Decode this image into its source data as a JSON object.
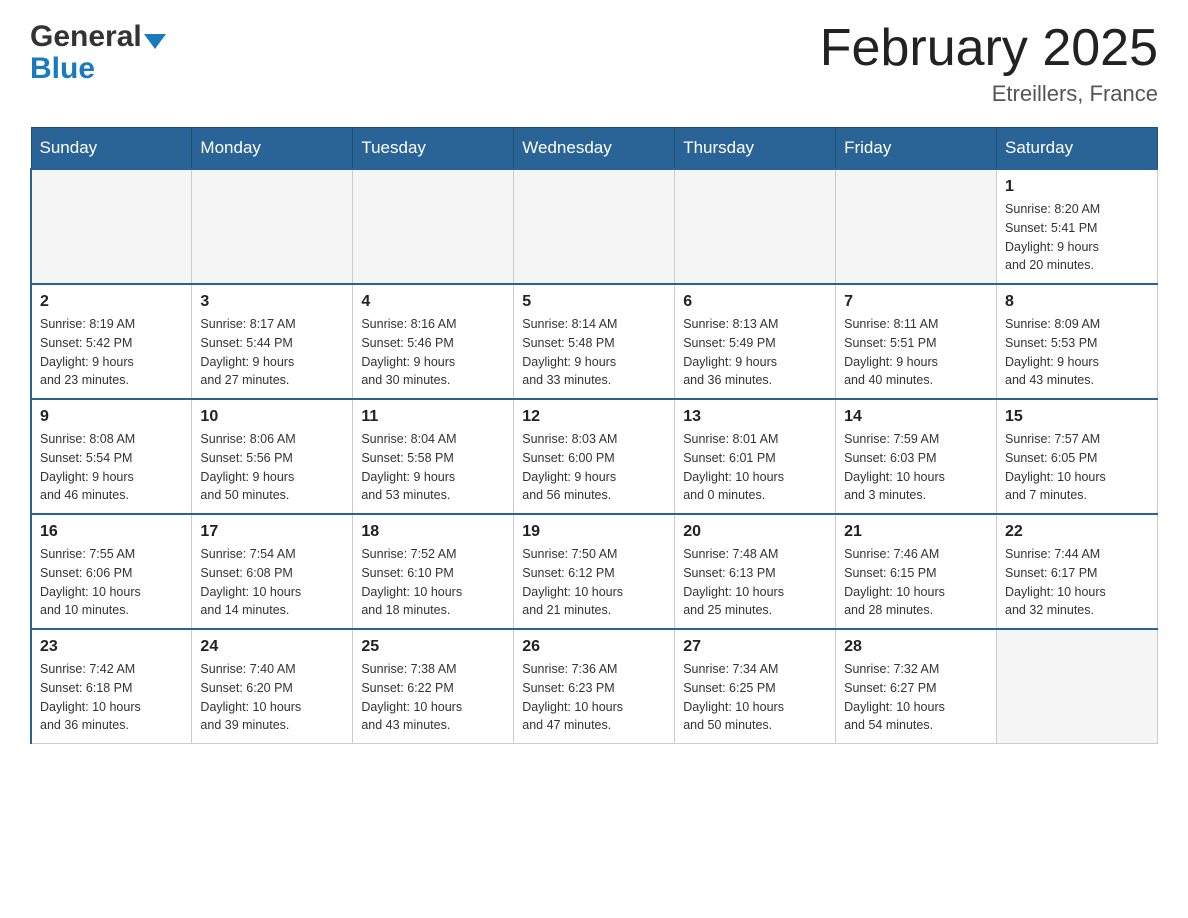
{
  "header": {
    "logo_general": "General",
    "logo_blue": "Blue",
    "month_title": "February 2025",
    "location": "Etreillers, France"
  },
  "weekdays": [
    "Sunday",
    "Monday",
    "Tuesday",
    "Wednesday",
    "Thursday",
    "Friday",
    "Saturday"
  ],
  "weeks": [
    [
      {
        "day": "",
        "info": ""
      },
      {
        "day": "",
        "info": ""
      },
      {
        "day": "",
        "info": ""
      },
      {
        "day": "",
        "info": ""
      },
      {
        "day": "",
        "info": ""
      },
      {
        "day": "",
        "info": ""
      },
      {
        "day": "1",
        "info": "Sunrise: 8:20 AM\nSunset: 5:41 PM\nDaylight: 9 hours\nand 20 minutes."
      }
    ],
    [
      {
        "day": "2",
        "info": "Sunrise: 8:19 AM\nSunset: 5:42 PM\nDaylight: 9 hours\nand 23 minutes."
      },
      {
        "day": "3",
        "info": "Sunrise: 8:17 AM\nSunset: 5:44 PM\nDaylight: 9 hours\nand 27 minutes."
      },
      {
        "day": "4",
        "info": "Sunrise: 8:16 AM\nSunset: 5:46 PM\nDaylight: 9 hours\nand 30 minutes."
      },
      {
        "day": "5",
        "info": "Sunrise: 8:14 AM\nSunset: 5:48 PM\nDaylight: 9 hours\nand 33 minutes."
      },
      {
        "day": "6",
        "info": "Sunrise: 8:13 AM\nSunset: 5:49 PM\nDaylight: 9 hours\nand 36 minutes."
      },
      {
        "day": "7",
        "info": "Sunrise: 8:11 AM\nSunset: 5:51 PM\nDaylight: 9 hours\nand 40 minutes."
      },
      {
        "day": "8",
        "info": "Sunrise: 8:09 AM\nSunset: 5:53 PM\nDaylight: 9 hours\nand 43 minutes."
      }
    ],
    [
      {
        "day": "9",
        "info": "Sunrise: 8:08 AM\nSunset: 5:54 PM\nDaylight: 9 hours\nand 46 minutes."
      },
      {
        "day": "10",
        "info": "Sunrise: 8:06 AM\nSunset: 5:56 PM\nDaylight: 9 hours\nand 50 minutes."
      },
      {
        "day": "11",
        "info": "Sunrise: 8:04 AM\nSunset: 5:58 PM\nDaylight: 9 hours\nand 53 minutes."
      },
      {
        "day": "12",
        "info": "Sunrise: 8:03 AM\nSunset: 6:00 PM\nDaylight: 9 hours\nand 56 minutes."
      },
      {
        "day": "13",
        "info": "Sunrise: 8:01 AM\nSunset: 6:01 PM\nDaylight: 10 hours\nand 0 minutes."
      },
      {
        "day": "14",
        "info": "Sunrise: 7:59 AM\nSunset: 6:03 PM\nDaylight: 10 hours\nand 3 minutes."
      },
      {
        "day": "15",
        "info": "Sunrise: 7:57 AM\nSunset: 6:05 PM\nDaylight: 10 hours\nand 7 minutes."
      }
    ],
    [
      {
        "day": "16",
        "info": "Sunrise: 7:55 AM\nSunset: 6:06 PM\nDaylight: 10 hours\nand 10 minutes."
      },
      {
        "day": "17",
        "info": "Sunrise: 7:54 AM\nSunset: 6:08 PM\nDaylight: 10 hours\nand 14 minutes."
      },
      {
        "day": "18",
        "info": "Sunrise: 7:52 AM\nSunset: 6:10 PM\nDaylight: 10 hours\nand 18 minutes."
      },
      {
        "day": "19",
        "info": "Sunrise: 7:50 AM\nSunset: 6:12 PM\nDaylight: 10 hours\nand 21 minutes."
      },
      {
        "day": "20",
        "info": "Sunrise: 7:48 AM\nSunset: 6:13 PM\nDaylight: 10 hours\nand 25 minutes."
      },
      {
        "day": "21",
        "info": "Sunrise: 7:46 AM\nSunset: 6:15 PM\nDaylight: 10 hours\nand 28 minutes."
      },
      {
        "day": "22",
        "info": "Sunrise: 7:44 AM\nSunset: 6:17 PM\nDaylight: 10 hours\nand 32 minutes."
      }
    ],
    [
      {
        "day": "23",
        "info": "Sunrise: 7:42 AM\nSunset: 6:18 PM\nDaylight: 10 hours\nand 36 minutes."
      },
      {
        "day": "24",
        "info": "Sunrise: 7:40 AM\nSunset: 6:20 PM\nDaylight: 10 hours\nand 39 minutes."
      },
      {
        "day": "25",
        "info": "Sunrise: 7:38 AM\nSunset: 6:22 PM\nDaylight: 10 hours\nand 43 minutes."
      },
      {
        "day": "26",
        "info": "Sunrise: 7:36 AM\nSunset: 6:23 PM\nDaylight: 10 hours\nand 47 minutes."
      },
      {
        "day": "27",
        "info": "Sunrise: 7:34 AM\nSunset: 6:25 PM\nDaylight: 10 hours\nand 50 minutes."
      },
      {
        "day": "28",
        "info": "Sunrise: 7:32 AM\nSunset: 6:27 PM\nDaylight: 10 hours\nand 54 minutes."
      },
      {
        "day": "",
        "info": ""
      }
    ]
  ]
}
